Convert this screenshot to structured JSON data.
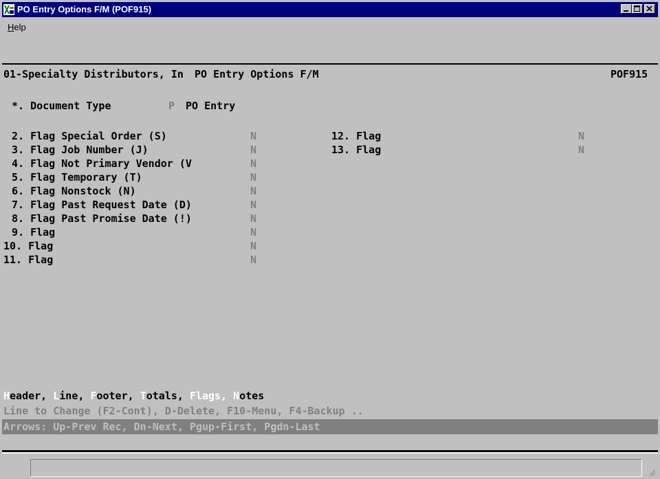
{
  "window": {
    "title": "PO Entry Options F/M (POF915)",
    "menu": {
      "help_prefix": "H",
      "help_rest": "elp"
    }
  },
  "screen": {
    "company": "01-Specialty Distributors, In",
    "screen_title": "PO Entry Options F/M",
    "program": "POF915",
    "doc_type": {
      "label": "*. Document Type",
      "code": "P",
      "desc": "PO Entry"
    },
    "left_flags": [
      {
        "label": "2. Flag Special Order (S)",
        "value": "N"
      },
      {
        "label": "3. Flag Job Number (J)",
        "value": "N"
      },
      {
        "label": "4. Flag Not Primary Vendor (V",
        "value": "N"
      },
      {
        "label": "5. Flag Temporary (T)",
        "value": "N"
      },
      {
        "label": "6. Flag Nonstock (N)",
        "value": "N"
      },
      {
        "label": "7. Flag Past Request Date (D)",
        "value": "N"
      },
      {
        "label": "8. Flag Past Promise Date (!)",
        "value": "N"
      },
      {
        "label": "9. Flag",
        "value": "N"
      },
      {
        "label": "10. Flag",
        "value": "N"
      },
      {
        "label": "11. Flag",
        "value": "N"
      }
    ],
    "right_flags": [
      {
        "label": "12. Flag",
        "value": "N"
      },
      {
        "label": "13. Flag",
        "value": "N"
      }
    ],
    "sections": {
      "header_first": "H",
      "header_rest": "eader,",
      "line_first": "L",
      "line_rest": "ine,",
      "footer_first": "F",
      "footer_rest": "ooter,",
      "totals_first": "T",
      "totals_rest": "otals,",
      "flags": "Flags,",
      "notes_first": "N",
      "notes_rest": "otes"
    },
    "prompt": "Line to Change (F2-Cont), D-Delete, F10-Menu, F4-Backup ..",
    "status": "Arrows: Up-Prev Rec, Dn-Next, Pgup-First, Pgdn-Last"
  }
}
